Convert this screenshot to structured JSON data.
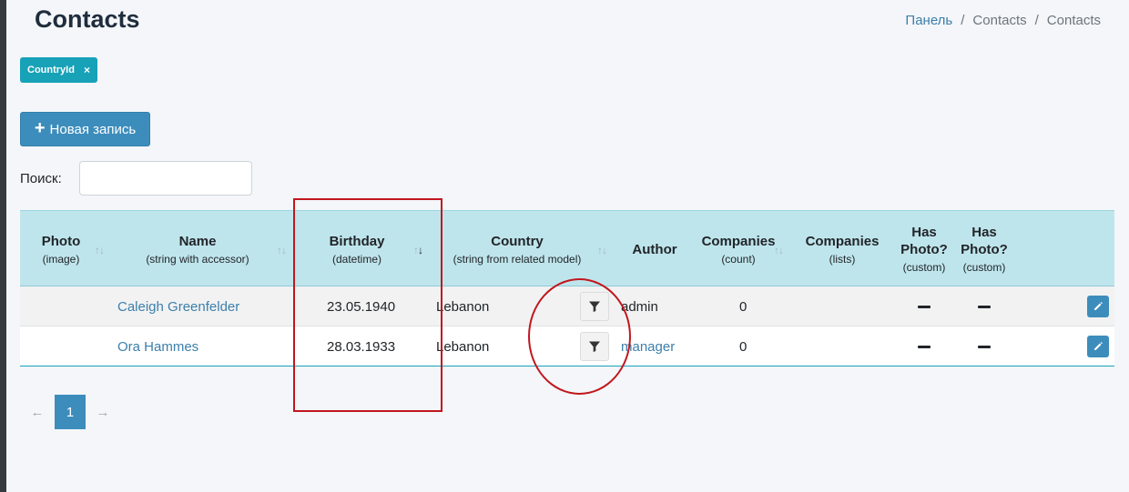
{
  "page": {
    "title": "Contacts"
  },
  "breadcrumb": {
    "items": [
      "Панель",
      "Contacts",
      "Contacts"
    ],
    "separator": "/"
  },
  "filter_tag": {
    "label": "CountryId",
    "close": "×"
  },
  "toolbar": {
    "new_label": "Новая запись",
    "new_icon": "+"
  },
  "search": {
    "label": "Поиск:",
    "value": "",
    "placeholder": ""
  },
  "table": {
    "columns": [
      {
        "title": "Photo",
        "sub": "(image)"
      },
      {
        "title": "Name",
        "sub": "(string with accessor)"
      },
      {
        "title": "Birthday",
        "sub": "(datetime)"
      },
      {
        "title": "Country",
        "sub": "(string from related model)"
      },
      {
        "title": "Author",
        "sub": ""
      },
      {
        "title": "Companies",
        "sub": "(count)"
      },
      {
        "title": "Companies",
        "sub": "(lists)"
      },
      {
        "title": "Has Photo?",
        "sub": "(custom)"
      },
      {
        "title": "Has Photo?",
        "sub": "(custom)"
      }
    ],
    "sort_icon": "↑↓",
    "sorted_column": "Birthday",
    "rows": [
      {
        "name": "Caleigh Greenfelder",
        "birthday": "23.05.1940",
        "country": "Lebanon",
        "author": "admin",
        "companies_count": "0"
      },
      {
        "name": "Ora Hammes",
        "birthday": "28.03.1933",
        "country": "Lebanon",
        "author": "manager",
        "companies_count": "0"
      }
    ]
  },
  "pagination": {
    "prev": "←",
    "current": "1",
    "next": "→"
  },
  "colors": {
    "accent": "#3c8dbc",
    "header_bg": "#bfe5ec",
    "tag": "#17a2b8",
    "annotation": "#c0171d"
  },
  "icons": {
    "filter": "funnel-icon",
    "edit": "pencil-icon",
    "sort": "sort-icon"
  }
}
